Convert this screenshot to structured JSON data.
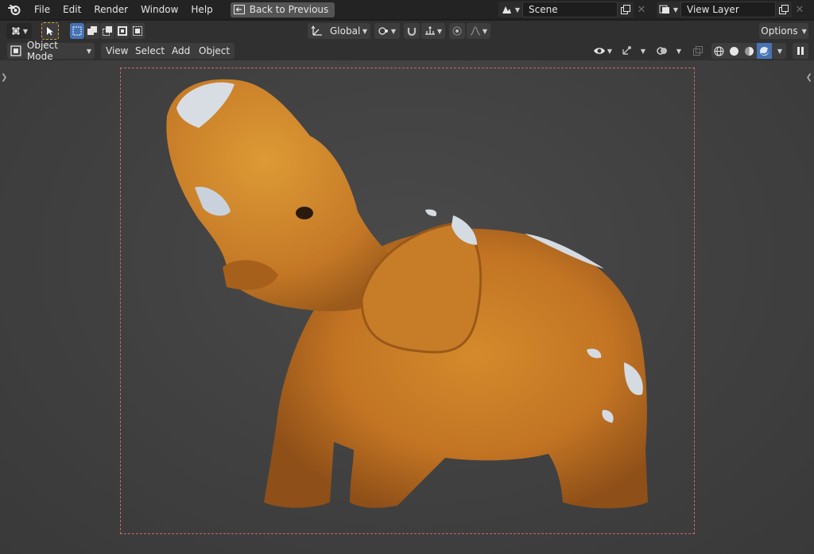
{
  "topbar": {
    "menus": [
      "File",
      "Edit",
      "Render",
      "Window",
      "Help"
    ],
    "back_button_label": "Back to Previous",
    "scene_name": "Scene",
    "view_layer_name": "View Layer"
  },
  "header": {
    "transform_orientation": "Global",
    "options_label": "Options"
  },
  "subheader": {
    "mode": "Object Mode",
    "menus": [
      "View",
      "Select",
      "Add",
      "Object"
    ]
  },
  "colors": {
    "accent_blue": "#4772b3",
    "camera_frame": "#c96a6a",
    "viewport_bg": "#404040"
  }
}
